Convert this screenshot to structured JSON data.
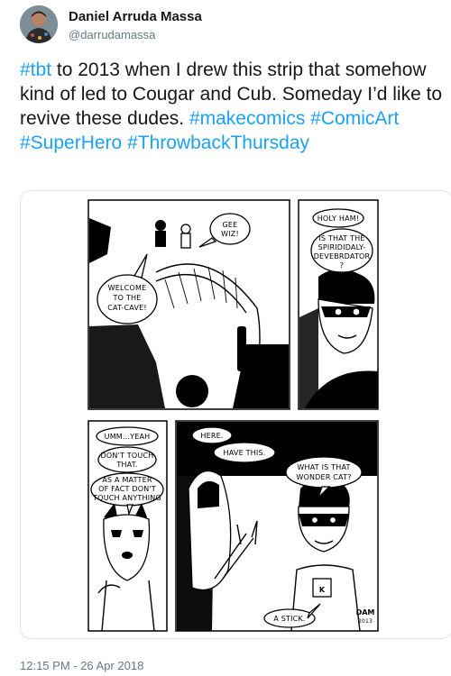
{
  "author": {
    "name": "Daniel Arruda Massa",
    "handle": "@darrudamassa"
  },
  "tweet": {
    "segments": [
      {
        "text": "#tbt",
        "hashtag": true
      },
      {
        "text": " to 2013 when I drew this strip that somehow kind of led to Cougar and Cub. Someday I’d like to revive these dudes. ",
        "hashtag": false
      },
      {
        "text": "#makecomics",
        "hashtag": true
      },
      {
        "text": " ",
        "hashtag": false
      },
      {
        "text": "#ComicArt",
        "hashtag": true
      },
      {
        "text": " ",
        "hashtag": false
      },
      {
        "text": "#SuperHero",
        "hashtag": true
      },
      {
        "text": " ",
        "hashtag": false
      },
      {
        "text": "#ThrowbackThursday",
        "hashtag": true
      }
    ],
    "timestamp": "12:15 PM - 26 Apr 2018"
  },
  "comic": {
    "panel1": {
      "bubble_gee": [
        "GEE",
        "WIZ!"
      ],
      "bubble_welcome": [
        "WELCOME",
        "TO THE",
        "CAT-CAVE!"
      ]
    },
    "panel2": {
      "bubble_holy": [
        "HOLY HAM!"
      ],
      "bubble_is": [
        "IS THAT THE",
        "SPIRIDIDALY-",
        "DEVEBRDATOR",
        "?"
      ]
    },
    "panel3": {
      "bubble_umm": [
        "UMM...YEAH"
      ],
      "bubble_dont": [
        "DON'T TOUCH",
        "THAT."
      ],
      "bubble_matter": [
        "AS A MATTER",
        "OF FACT DON'T",
        "TOUCH ANYTHING"
      ]
    },
    "panel4": {
      "bubble_here": [
        "HERE."
      ],
      "bubble_have": [
        "HAVE THIS."
      ],
      "bubble_what": [
        "WHAT IS THAT",
        "WONDER CAT?"
      ],
      "bubble_stick": [
        "A STICK."
      ],
      "emblem": "K",
      "signature": [
        "DAM",
        "2013"
      ]
    }
  },
  "colors": {
    "hashtag": "#1da1f2",
    "text": "#14171a",
    "muted": "#657786"
  }
}
